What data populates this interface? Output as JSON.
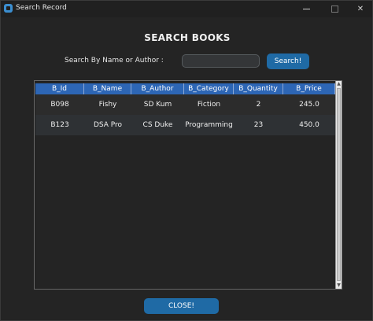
{
  "window": {
    "title": "Search Record",
    "minimize_icon": "minimize-icon",
    "maximize_icon": "maximize-icon",
    "close_glyph": "✕"
  },
  "page": {
    "heading": "SEARCH BOOKS",
    "search_label": "Search By Name or Author :",
    "search_value": "",
    "search_button": "Search!",
    "close_button": "CLOSE!"
  },
  "colors": {
    "background": "#242424",
    "accent_button": "#1f6aa5",
    "table_header": "#2d66b5"
  },
  "table": {
    "columns": [
      "B_Id",
      "B_Name",
      "B_Author",
      "B_Category",
      "B_Quantity",
      "B_Price"
    ],
    "rows": [
      [
        "B098",
        "Fishy",
        "SD Kum",
        "Fiction",
        "2",
        "245.0"
      ],
      [
        "B123",
        "DSA Pro",
        "CS Duke",
        "Programming",
        "23",
        "450.0"
      ]
    ]
  }
}
